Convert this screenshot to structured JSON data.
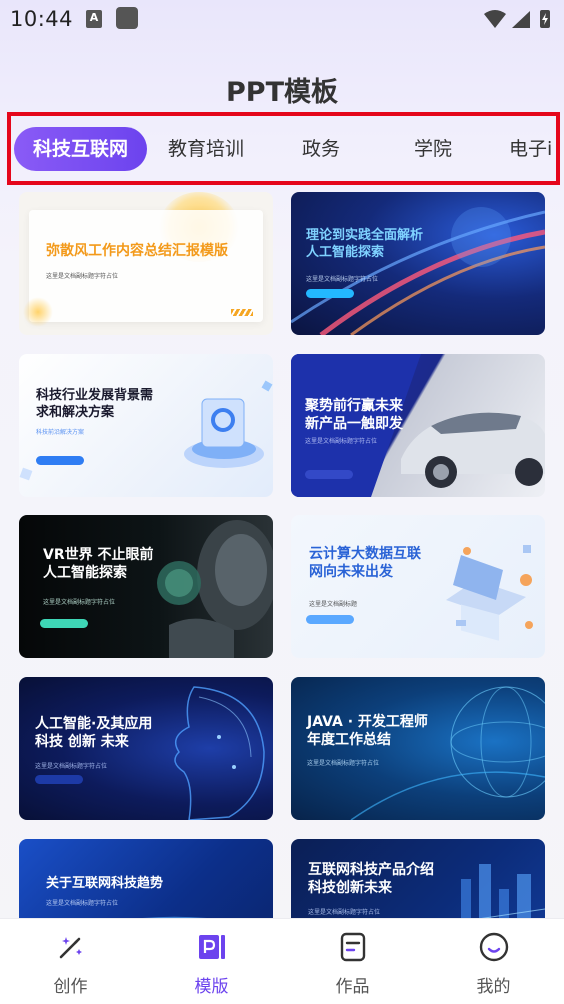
{
  "status_bar": {
    "time": "10:44",
    "a_icon_letter": "A"
  },
  "page_title": "PPT模板",
  "tabs": [
    {
      "label": "科技互联网",
      "active": true
    },
    {
      "label": "教育培训"
    },
    {
      "label": "政务"
    },
    {
      "label": "学院"
    },
    {
      "label": "电子i"
    }
  ],
  "cards": [
    {
      "title": "弥散风工作内容总结汇报模版",
      "subtitle": "这里是文档副标题字符占位"
    },
    {
      "title": "理论到实践全面解析\n人工智能探索",
      "subtitle": "这里是文档副标题字符占位"
    },
    {
      "title": "科技行业发展背景需\n求和解决方案",
      "subtitle": "科技前沿解决方案"
    },
    {
      "title": "聚势前行赢未来\n新产品一触即发",
      "subtitle": "这里是文档副标题字符占位"
    },
    {
      "title": "VR世界 不止眼前\n人工智能探索",
      "subtitle": "这里是文档副标题字符占位"
    },
    {
      "title": "云计算大数据互联\n网向未来出发",
      "subtitle": "这里是文档副标题"
    },
    {
      "title": "人工智能·及其应用\n科技 创新 未来",
      "subtitle": "这里是文档副标题字符占位"
    },
    {
      "title": "JAVA · 开发工程师\n年度工作总结",
      "subtitle": "这里是文档副标题字符占位"
    },
    {
      "title": "关于互联网科技趋势",
      "subtitle": "这里是文档副标题字符占位"
    },
    {
      "title": "互联网科技产品介绍\n科技创新未来",
      "subtitle": "这里是文档副标题字符占位"
    }
  ],
  "bottom_nav": [
    {
      "label": "创作",
      "icon": "magic-wand-icon"
    },
    {
      "label": "模版",
      "icon": "ppt-icon",
      "active": true
    },
    {
      "label": "作品",
      "icon": "document-icon"
    },
    {
      "label": "我的",
      "icon": "smile-face-icon"
    }
  ],
  "colors": {
    "accent": "#6c43ee",
    "tab_outline": "#e5061b"
  }
}
